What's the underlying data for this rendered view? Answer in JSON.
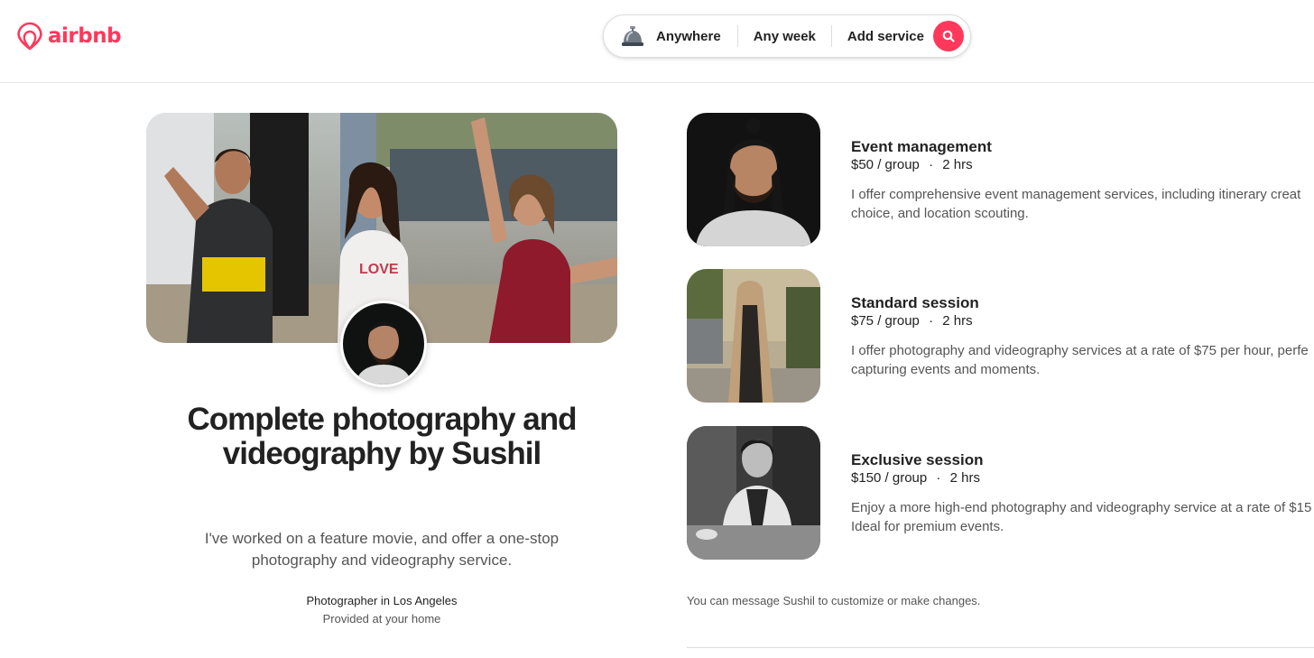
{
  "header": {
    "logo_text": "airbnb",
    "search": {
      "icon": "service-bell-icon",
      "where": "Anywhere",
      "when": "Any week",
      "what": "Add service"
    }
  },
  "listing": {
    "title": "Complete photography and videography by Sushil",
    "description": "I've worked on a feature movie, and offer a one-stop photography and videography service.",
    "host_role": "Photographer in Los Angeles",
    "location": "Provided at your home"
  },
  "services": [
    {
      "name": "Event management",
      "price": "$50 / group",
      "separator": "·",
      "duration": "2 hrs",
      "desc_line1": "I offer comprehensive event management services, including itinerary creat",
      "desc_line2": "choice, and location scouting."
    },
    {
      "name": "Standard session",
      "price": "$75 / group",
      "separator": "·",
      "duration": "2 hrs",
      "desc_line1": "I offer photography and videography services at a rate of $75 per hour, perfe",
      "desc_line2": "capturing events and moments."
    },
    {
      "name": "Exclusive session",
      "price": "$150 / group",
      "separator": "·",
      "duration": "2 hrs",
      "desc_line1": "Enjoy a more high-end photography and videography service at a rate of $15",
      "desc_line2": "Ideal for premium events."
    }
  ],
  "note": "You can message Sushil to customize or make changes.",
  "colors": {
    "brand": "#ff385c",
    "text": "#222222",
    "muted": "#555555",
    "border": "#dddddd"
  }
}
